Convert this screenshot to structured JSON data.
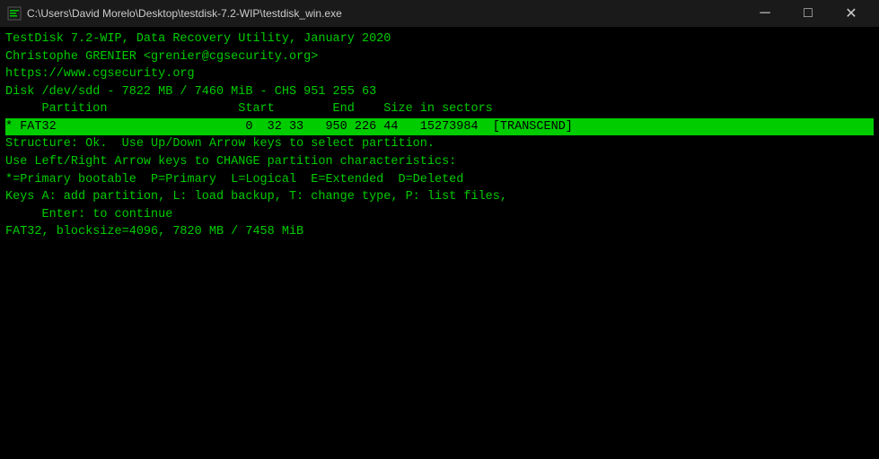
{
  "titlebar": {
    "icon": "▪",
    "title": "C:\\Users\\David Morelo\\Desktop\\testdisk-7.2-WIP\\testdisk_win.exe",
    "minimize": "─",
    "maximize": "□",
    "close": "✕"
  },
  "terminal": {
    "lines": [
      "TestDisk 7.2-WIP, Data Recovery Utility, January 2020",
      "Christophe GRENIER <grenier@cgsecurity.org>",
      "https://www.cgsecurity.org",
      "",
      "Disk /dev/sdd - 7822 MB / 7460 MiB - CHS 951 255 63",
      "     Partition                  Start        End    Size in sectors",
      "* FAT32                          0  32 33   950 226 44   15273984  [TRANSCEND]",
      "",
      "",
      "",
      "",
      "",
      "",
      "",
      "",
      "",
      "",
      "",
      "",
      "",
      "",
      "Structure: Ok.  Use Up/Down Arrow keys to select partition.",
      "Use Left/Right Arrow keys to CHANGE partition characteristics:",
      "*=Primary bootable  P=Primary  L=Logical  E=Extended  D=Deleted",
      "Keys A: add partition, L: load backup, T: change type, P: list files,",
      "     Enter: to continue",
      "FAT32, blocksize=4096, 7820 MB / 7458 MiB"
    ],
    "highlighted_line_index": 6
  }
}
